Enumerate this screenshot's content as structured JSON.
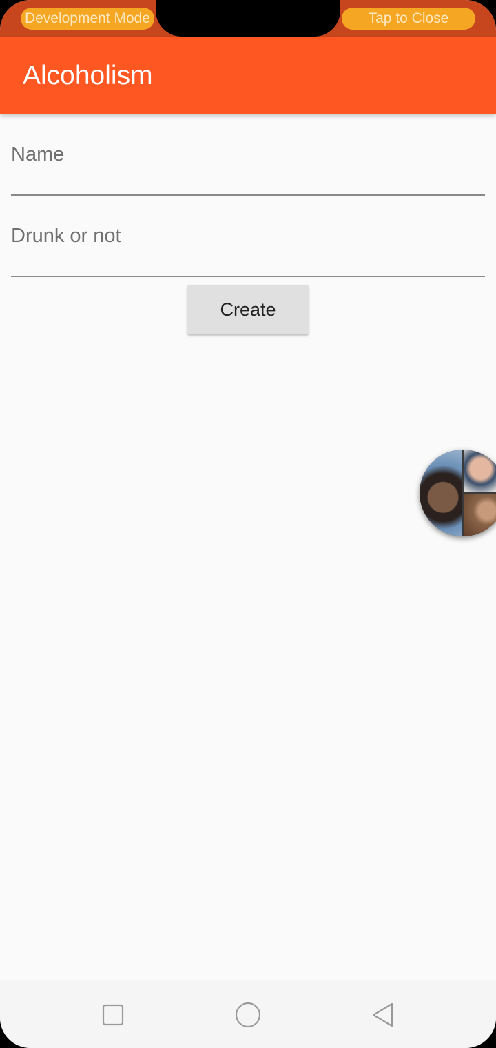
{
  "status_bar": {
    "dev_mode_label": "Development Mode",
    "tap_to_close_label": "Tap to Close"
  },
  "app_bar": {
    "title": "Alcoholism",
    "color": "#ff5722"
  },
  "form": {
    "name_field": {
      "value": "",
      "placeholder": "Name"
    },
    "drunk_field": {
      "value": "",
      "placeholder": "Drunk or not"
    },
    "create_label": "Create"
  },
  "chat_head": {
    "icon": "group-avatar-icon"
  },
  "nav_bar": {
    "recent_icon": "square-icon",
    "home_icon": "circle-icon",
    "back_icon": "triangle-back-icon"
  },
  "colors": {
    "accent": "#ff5722",
    "status_bar": "#c7461d",
    "dev_pill": "#f5a623",
    "background": "#fafafa",
    "button": "#e0e0e0"
  }
}
